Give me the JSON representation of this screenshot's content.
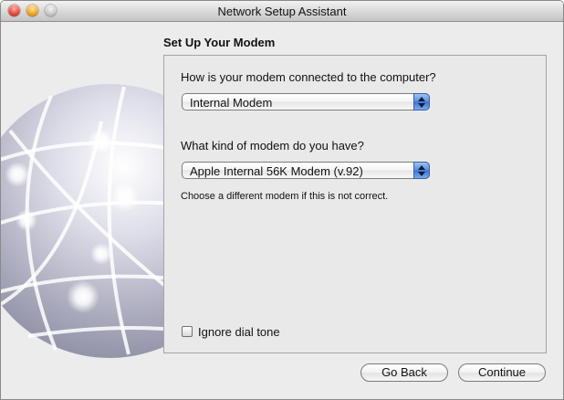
{
  "window": {
    "title": "Network Setup Assistant"
  },
  "step": {
    "title": "Set Up Your Modem"
  },
  "connection": {
    "question": "How is your modem connected to the computer?",
    "selected": "Internal Modem"
  },
  "modem": {
    "question": "What kind of modem do you have?",
    "selected": "Apple Internal 56K Modem (v.92)",
    "hint": "Choose a different modem if this is not correct."
  },
  "options": {
    "ignore_dial_tone_label": "Ignore dial tone",
    "ignore_dial_tone_checked": false
  },
  "buttons": {
    "back": "Go Back",
    "continue": "Continue"
  },
  "icons": {
    "close": "close-light-icon",
    "minimize": "minimize-light-icon",
    "zoom": "zoom-light-icon",
    "globe": "network-globe-icon",
    "popup_arrows": "up-down-arrows-icon"
  }
}
